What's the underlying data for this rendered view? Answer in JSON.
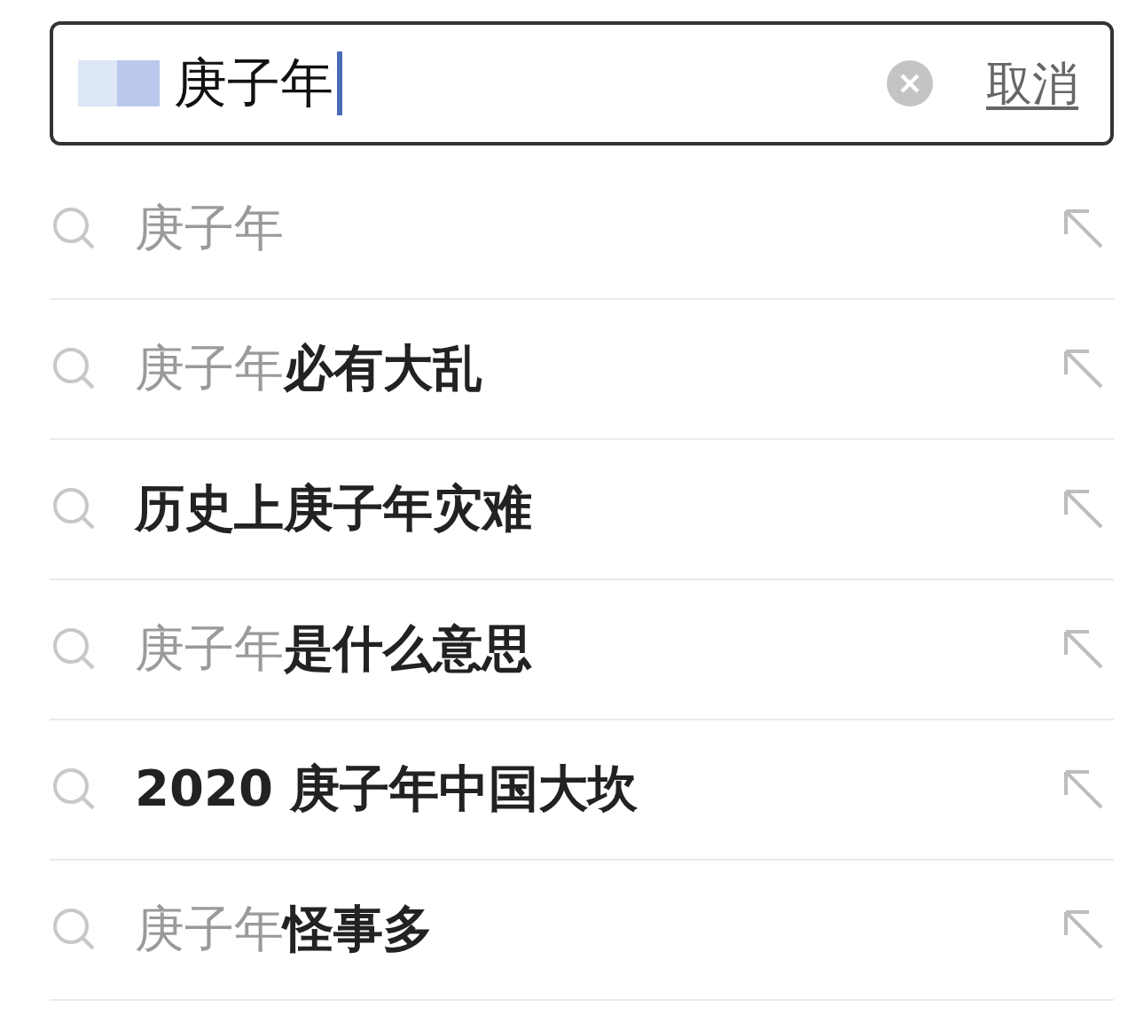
{
  "search": {
    "value": "庚子年",
    "cancel": "取消"
  },
  "suggestions": [
    {
      "text": "庚子年"
    },
    {
      "text": "庚子年**必有大乱**"
    },
    {
      "text": "**历史上庚子年灾难**"
    },
    {
      "text": "庚子年**是什么意思**"
    },
    {
      "text": "**2020 庚子年中国大坎**"
    },
    {
      "text": "庚子年**怪事多**"
    }
  ]
}
